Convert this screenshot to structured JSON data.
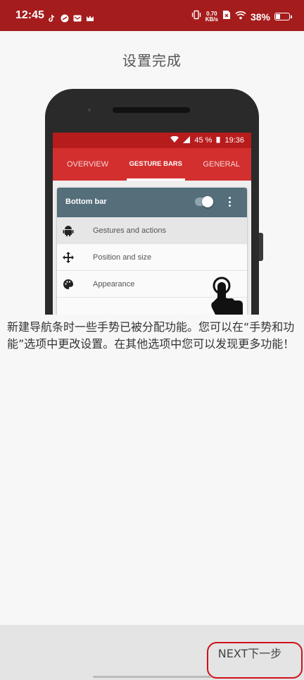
{
  "status_bar": {
    "time": "12:45",
    "net_speed": "0.70",
    "net_unit": "KB/s",
    "battery": "38%",
    "battery_level": 0.38,
    "bg_color": "#a51c1c",
    "icons": [
      "tiktok-icon",
      "app-icon",
      "mail-icon",
      "crown-icon",
      "vibrate-icon",
      "sim-icon",
      "wifi-icon",
      "battery-icon"
    ]
  },
  "page": {
    "title": "设置完成",
    "description": "新建导航条时一些手势已被分配功能。您可以在“手势和功能”选项中更改设置。在其他选项中您可以发现更多功能！",
    "next_label": "NEXT下一步"
  },
  "mockup": {
    "status": {
      "battery": "45 %",
      "time": "19:36"
    },
    "tabs": [
      {
        "label": "OVERVIEW",
        "active": false
      },
      {
        "label": "GESTURE BARS",
        "active": true
      },
      {
        "label": "GENERAL",
        "active": false
      }
    ],
    "card_title": "Bottom bar",
    "toggle_on": true,
    "rows": [
      {
        "label": "Gestures and actions",
        "icon": "android-icon",
        "highlighted": true
      },
      {
        "label": "Position and size",
        "icon": "move-icon",
        "highlighted": false
      },
      {
        "label": "Appearance",
        "icon": "palette-icon",
        "highlighted": false
      }
    ],
    "accent": "#d32f2f",
    "card_header_color": "#546e7a"
  }
}
